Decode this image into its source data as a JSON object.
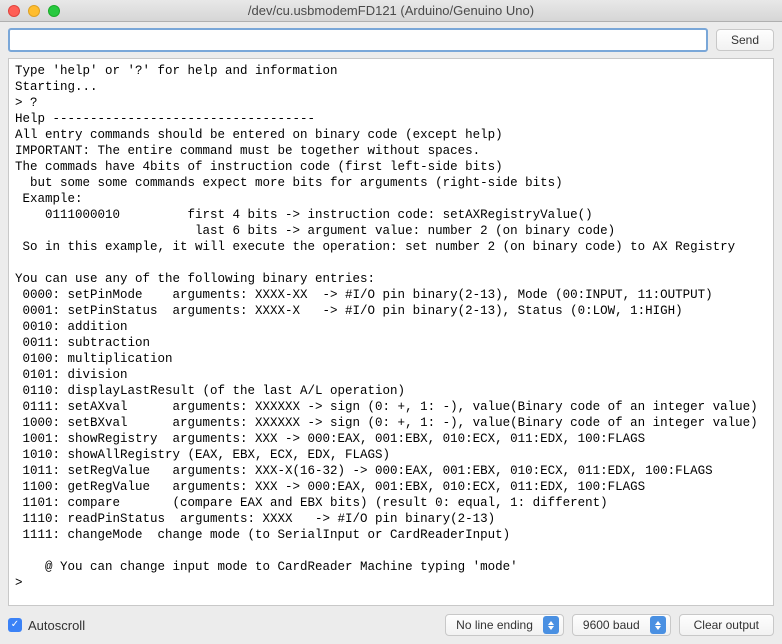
{
  "window": {
    "title": "/dev/cu.usbmodemFD121 (Arduino/Genuino Uno)"
  },
  "toolbar": {
    "input_value": "",
    "send_label": "Send"
  },
  "console": {
    "text": "Type 'help' or '?' for help and information\nStarting...\n> ?\nHelp -----------------------------------\nAll entry commands should be entered on binary code (except help)\nIMPORTANT: The entire command must be together without spaces.\nThe commads have 4bits of instruction code (first left-side bits)\n  but some some commands expect more bits for arguments (right-side bits)\n Example:\n    0111000010         first 4 bits -> instruction code: setAXRegistryValue()\n                        last 6 bits -> argument value: number 2 (on binary code)\n So in this example, it will execute the operation: set number 2 (on binary code) to AX Registry\n\nYou can use any of the following binary entries:\n 0000: setPinMode    arguments: XXXX-XX  -> #I/O pin binary(2-13), Mode (00:INPUT, 11:OUTPUT)\n 0001: setPinStatus  arguments: XXXX-X   -> #I/O pin binary(2-13), Status (0:LOW, 1:HIGH)\n 0010: addition\n 0011: subtraction\n 0100: multiplication\n 0101: division\n 0110: displayLastResult (of the last A/L operation)\n 0111: setAXval      arguments: XXXXXX -> sign (0: +, 1: -), value(Binary code of an integer value)\n 1000: setBXval      arguments: XXXXXX -> sign (0: +, 1: -), value(Binary code of an integer value)\n 1001: showRegistry  arguments: XXX -> 000:EAX, 001:EBX, 010:ECX, 011:EDX, 100:FLAGS\n 1010: showAllRegistry (EAX, EBX, ECX, EDX, FLAGS)\n 1011: setRegValue   arguments: XXX-X(16-32) -> 000:EAX, 001:EBX, 010:ECX, 011:EDX, 100:FLAGS\n 1100: getRegValue   arguments: XXX -> 000:EAX, 001:EBX, 010:ECX, 011:EDX, 100:FLAGS\n 1101: compare       (compare EAX and EBX bits) (result 0: equal, 1: different)\n 1110: readPinStatus  arguments: XXXX   -> #I/O pin binary(2-13)\n 1111: changeMode  change mode (to SerialInput or CardReaderInput)\n\n    @ You can change input mode to CardReader Machine typing 'mode'\n>"
  },
  "bottombar": {
    "autoscroll_label": "Autoscroll",
    "autoscroll_checked": true,
    "line_ending_selected": "No line ending",
    "baud_selected": "9600 baud",
    "clear_label": "Clear output"
  }
}
